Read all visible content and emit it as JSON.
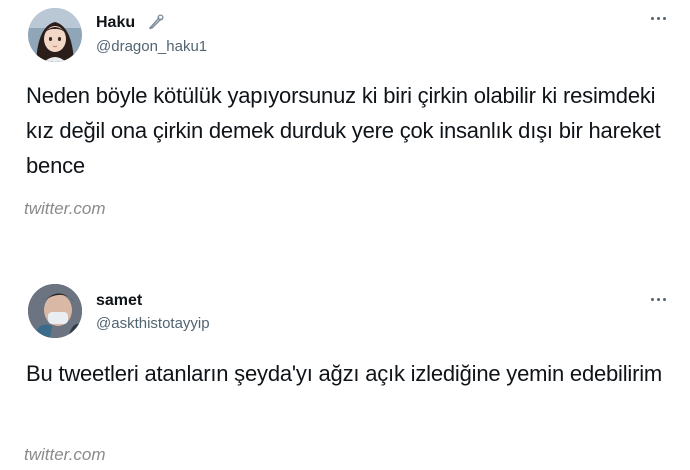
{
  "tweets": [
    {
      "display_name": "Haku",
      "handle": "@dragon_haku1",
      "text": "Neden böyle kötülük yapıyorsunuz ki biri çirkin olabilir ki resimdeki kız değil ona çirkin demek durduk yere çok insanlık dışı bir hareket bence",
      "watermark": "twitter.com",
      "badge_icon": "safety-pin-icon",
      "menu_icon": "more-options-icon"
    },
    {
      "display_name": "samet",
      "handle": "@askthistotayyip",
      "text": "Bu tweetleri atanların şeyda'yı ağzı açık izlediğine yemin edebilirim",
      "watermark": "twitter.com",
      "menu_icon": "more-options-icon"
    }
  ],
  "colors": {
    "text": "#0f1419",
    "secondary_text": "#536471",
    "watermark": "#8b8b8b",
    "background": "#ffffff"
  }
}
